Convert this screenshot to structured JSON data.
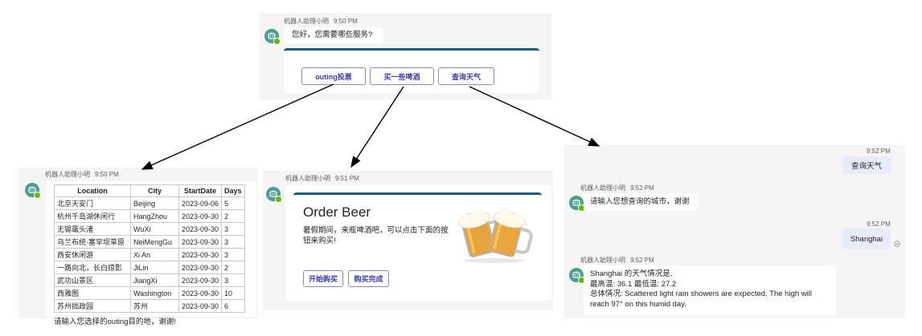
{
  "colors": {
    "panel": "#f5f5f5",
    "accent": "#1b5e75",
    "button_text": "#3d3da8",
    "out_bubble": "#e8ebfa"
  },
  "top": {
    "sender": "机器人助理小明",
    "time": "9:50 PM",
    "greeting": "您好，您需要哪些服务?",
    "buttons": [
      "outing投票",
      "买一些啤酒",
      "查询天气"
    ]
  },
  "left": {
    "sender": "机器人助理小明",
    "time": "9:50 PM",
    "table": {
      "headers": [
        "Location",
        "City",
        "StartDate",
        "Days"
      ],
      "rows": [
        [
          "北京天安门",
          "Beijing",
          "2023-09-06",
          "5"
        ],
        [
          "杭州千岛湖休闲行",
          "HangZhou",
          "2023-09-30",
          "2"
        ],
        [
          "无锡鼋头渚",
          "WuXi",
          "2023-09-30",
          "3"
        ],
        [
          "乌兰布统·塞罕坝草原",
          "NeiMengGu",
          "2023-09-30",
          "3"
        ],
        [
          "西安休闲游",
          "Xi An",
          "2023-09-30",
          "3"
        ],
        [
          "一路向北，长白掠影",
          "JiLin",
          "2023-09-30",
          "2"
        ],
        [
          "武功山景区",
          "JiangXi",
          "2023-09-30",
          "3"
        ],
        [
          "西雅图",
          "Washington",
          "2023-09-30",
          "10"
        ],
        [
          "苏州拙政园",
          "苏州",
          "2023-09-30",
          "6"
        ]
      ]
    },
    "footer": "请输入您选择的outing目的地，谢谢!"
  },
  "middle": {
    "sender": "机器人助理小明",
    "time": "9:51 PM",
    "title": "Order Beer",
    "body": "暑假期间，来瓶啤酒吧，可以点击下面的按钮来购买!",
    "buttons": [
      "开始购买",
      "购买完成"
    ]
  },
  "right": {
    "msg1_time": "9:52 PM",
    "msg1": "查询天气",
    "bot1_sender": "机器人助理小明",
    "bot1_time": "9:52 PM",
    "bot1_text": "请输入您想查询的城市，谢谢",
    "msg2_time": "9:52 PM",
    "msg2": "Shanghai",
    "bot2_sender": "机器人助理小明",
    "bot2_time": "9:52 PM",
    "bot2_lines": [
      "Shanghai 的天气情况是,",
      "最高温: 36.1 最低温: 27.2",
      "总体情况: Scattered light rain showers are expected. The high will",
      "reach 97° on this humid day."
    ]
  }
}
